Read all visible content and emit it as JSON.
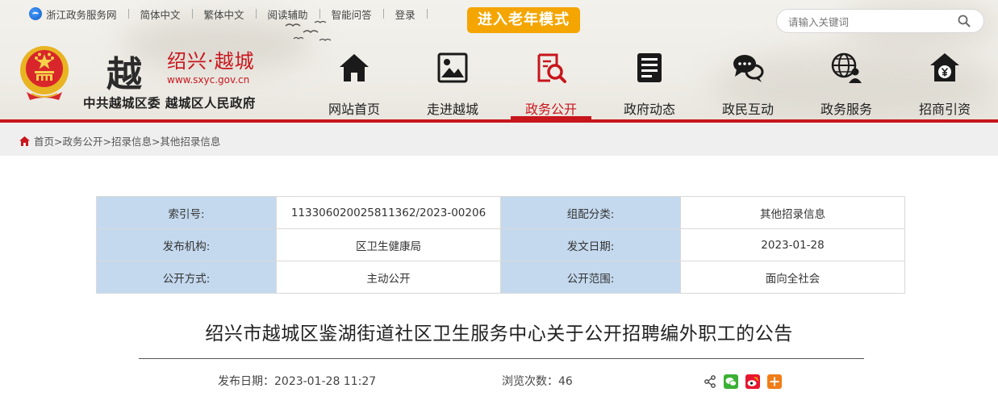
{
  "topbar": {
    "portal": "浙江政务服务网",
    "links": [
      "简体中文",
      "繁体中文",
      "阅读辅助",
      "智能问答",
      "登录"
    ],
    "elder_mode": "进入老年模式"
  },
  "search": {
    "placeholder": "请输入关键词"
  },
  "brand": {
    "logo_char": "越",
    "city": "绍兴·越城",
    "url": "www.sxyc.gov.cn",
    "org": "中共越城区委 越城区人民政府"
  },
  "nav": [
    {
      "label": "网站首页",
      "icon": "home-icon"
    },
    {
      "label": "走进越城",
      "icon": "picture-icon"
    },
    {
      "label": "政务公开",
      "icon": "document-search-icon",
      "active": true
    },
    {
      "label": "政府动态",
      "icon": "news-icon"
    },
    {
      "label": "政民互动",
      "icon": "chat-bubbles-icon"
    },
    {
      "label": "政务服务",
      "icon": "globe-user-icon"
    },
    {
      "label": "招商引资",
      "icon": "yuan-house-icon"
    }
  ],
  "breadcrumb": "首页>政务公开>招录信息>其他招录信息",
  "meta": [
    {
      "k1": "索引号:",
      "v1": "113306020025811362/2023-00206",
      "k2": "组配分类:",
      "v2": "其他招录信息"
    },
    {
      "k1": "发布机构:",
      "v1": "区卫生健康局",
      "k2": "发文日期:",
      "v2": "2023-01-28"
    },
    {
      "k1": "公开方式:",
      "v1": "主动公开",
      "k2": "公开范围:",
      "v2": "面向全社会"
    }
  ],
  "article": {
    "title": "绍兴市越城区鉴湖街道社区卫生服务中心关于公开招聘编外职工的公告",
    "publish": "发布日期：2023-01-28 11:27",
    "views": "浏览次数：46"
  },
  "colors": {
    "brand_red": "#c8161d",
    "elder_orange": "#f4a500",
    "table_key_bg": "#c4d9ee"
  }
}
